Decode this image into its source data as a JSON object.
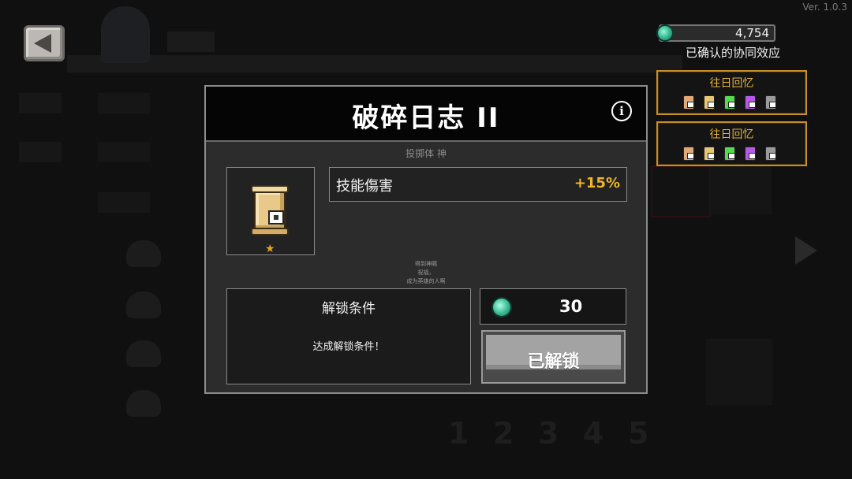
{
  "version": "Ver. 1.0.3",
  "currency": {
    "amount": "4,754",
    "icon": "gem-icon"
  },
  "synergy": {
    "title": "已确认的协同效应",
    "cards": [
      {
        "name": "往日回忆",
        "icon_colors": [
          "#e2a878",
          "#e6c774",
          "#55d94d",
          "#b65ae6",
          "#9a9a9a"
        ]
      },
      {
        "name": "往日回忆",
        "icon_colors": [
          "#e2a878",
          "#e6c774",
          "#55d94d",
          "#b65ae6",
          "#9a9a9a"
        ]
      }
    ]
  },
  "modal": {
    "title": "破碎日志 II",
    "info_icon": "info-icon",
    "subtitle": "投掷体 神",
    "item": {
      "icon": "scroll-icon",
      "rarity_icon": "star-icon"
    },
    "stat": {
      "name": "技能傷害",
      "value": "+15%"
    },
    "flavor": [
      "得到神賜",
      "祝福，",
      "成为英雄的人啊"
    ],
    "unlock": {
      "title": "解锁条件",
      "description": "达成解锁条件！"
    },
    "cost": {
      "value": "30",
      "icon": "gem-icon"
    },
    "status_button": "已解锁"
  },
  "colors": {
    "accent_gold": "#e6b236",
    "stat_value": "#f0b428",
    "gem": "#45c8a0"
  }
}
